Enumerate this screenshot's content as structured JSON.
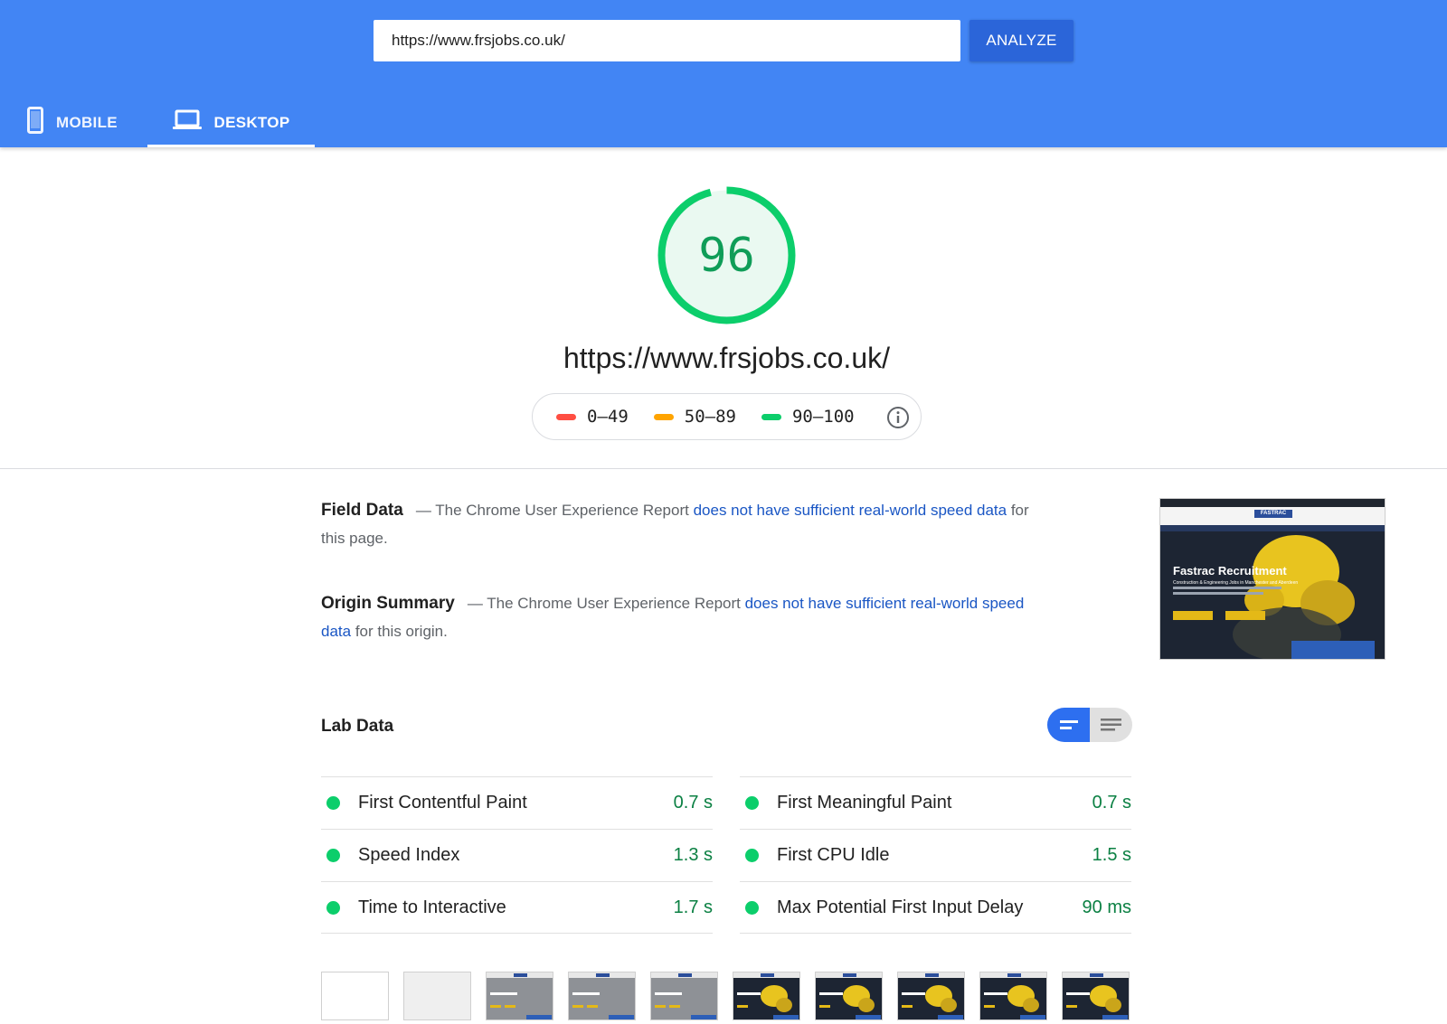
{
  "header": {
    "url_value": "https://www.frsjobs.co.uk/",
    "analyze_label": "ANALYZE",
    "tabs": [
      {
        "label": "MOBILE",
        "icon": "phone-icon",
        "active": false
      },
      {
        "label": "DESKTOP",
        "icon": "laptop-icon",
        "active": true
      }
    ]
  },
  "score": {
    "value": "96",
    "fraction": 0.96,
    "color": "#0cce6b",
    "url": "https://www.frsjobs.co.uk/"
  },
  "legend": {
    "items": [
      {
        "range": "0–49",
        "color": "#ff4e42"
      },
      {
        "range": "50–89",
        "color": "#ffa400"
      },
      {
        "range": "90–100",
        "color": "#0cce6b"
      }
    ],
    "info_icon": "info-icon"
  },
  "field_data": {
    "heading": "Field Data",
    "prefix": "— The Chrome User Experience Report ",
    "link": "does not have sufficient real-world speed data",
    "suffix": " for this page."
  },
  "origin_summary": {
    "heading": "Origin Summary",
    "prefix": "— The Chrome User Experience Report ",
    "link": "does not have sufficient real-world speed data",
    "suffix": " for this origin."
  },
  "preview": {
    "title": "Fastrac Recruitment",
    "subtitle": "Construction & Engineering Jobs in Manchester and Aberdeen",
    "logo": "FASTRAC"
  },
  "lab_data": {
    "title": "Lab Data",
    "left": [
      {
        "name": "First Contentful Paint",
        "value": "0.7 s"
      },
      {
        "name": "Speed Index",
        "value": "1.3 s"
      },
      {
        "name": "Time to Interactive",
        "value": "1.7 s"
      }
    ],
    "right": [
      {
        "name": "First Meaningful Paint",
        "value": "0.7 s"
      },
      {
        "name": "First CPU Idle",
        "value": "1.5 s"
      },
      {
        "name": "Max Potential First Input Delay",
        "value": "90 ms"
      }
    ]
  }
}
